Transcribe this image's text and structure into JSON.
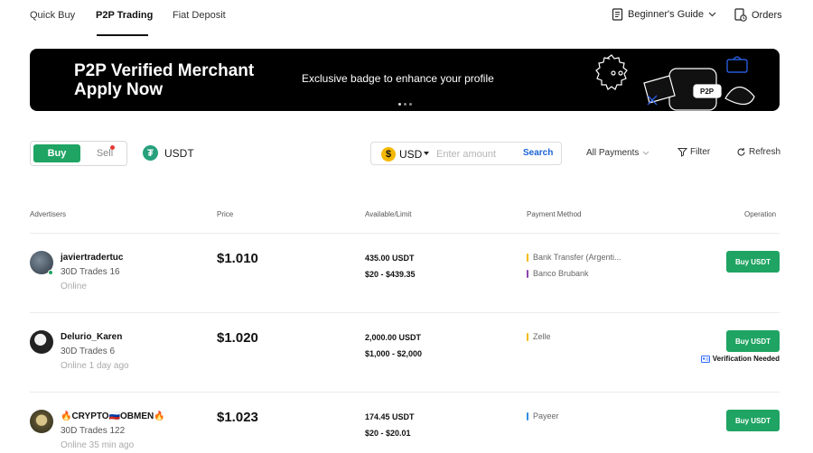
{
  "topnav": {
    "tabs": [
      {
        "label": "Quick Buy"
      },
      {
        "label": "P2P Trading"
      },
      {
        "label": "Fiat Deposit"
      }
    ],
    "guide_label": "Beginner's Guide",
    "orders_label": "Orders"
  },
  "banner": {
    "title": "P2P Verified Merchant\nApply Now",
    "subtitle": "Exclusive badge to enhance your profile",
    "art_badge": "P2P"
  },
  "filters": {
    "buy_label": "Buy",
    "sell_label": "Sell",
    "asset": "USDT",
    "currency_symbol": "$",
    "currency": "USD",
    "amount_placeholder": "Enter amount",
    "search_label": "Search",
    "payments_label": "All Payments",
    "filter_label": "Filter",
    "refresh_label": "Refresh"
  },
  "table": {
    "headers": {
      "advertisers": "Advertisers",
      "price": "Price",
      "available": "Available/Limit",
      "payment": "Payment Method",
      "operation": "Operation"
    },
    "rows": [
      {
        "name": "javiertradertuc",
        "trades": "30D Trades 16",
        "status": "Online",
        "price": "$1.010",
        "available": "435.00 USDT",
        "limit": "$20 - $439.35",
        "payments": [
          "Bank Transfer (Argenti...",
          "Banco Brubank"
        ],
        "payment_colors": [
          "#f5b800",
          "#8e44ad"
        ],
        "button": "Buy USDT",
        "note": ""
      },
      {
        "name": "Delurio_Karen",
        "trades": "30D Trades 6",
        "status": "Online 1 day ago",
        "price": "$1.020",
        "available": "2,000.00 USDT",
        "limit": "$1,000 - $2,000",
        "payments": [
          "Zelle"
        ],
        "payment_colors": [
          "#f5b800"
        ],
        "button": "Buy USDT",
        "note": "Verification Needed"
      },
      {
        "name": "🔥CRYPTO🇷🇺OBMEN🔥",
        "trades": "30D Trades 122",
        "status": "Online 35 min ago",
        "price": "$1.023",
        "available": "174.45 USDT",
        "limit": "$20 - $20.01",
        "payments": [
          "Payeer"
        ],
        "payment_colors": [
          "#2f8de4"
        ],
        "button": "Buy USDT",
        "note": ""
      }
    ]
  },
  "colors": {
    "accent_green": "#1fa463",
    "link_blue": "#1a62d6",
    "banner_bg": "#000000"
  }
}
